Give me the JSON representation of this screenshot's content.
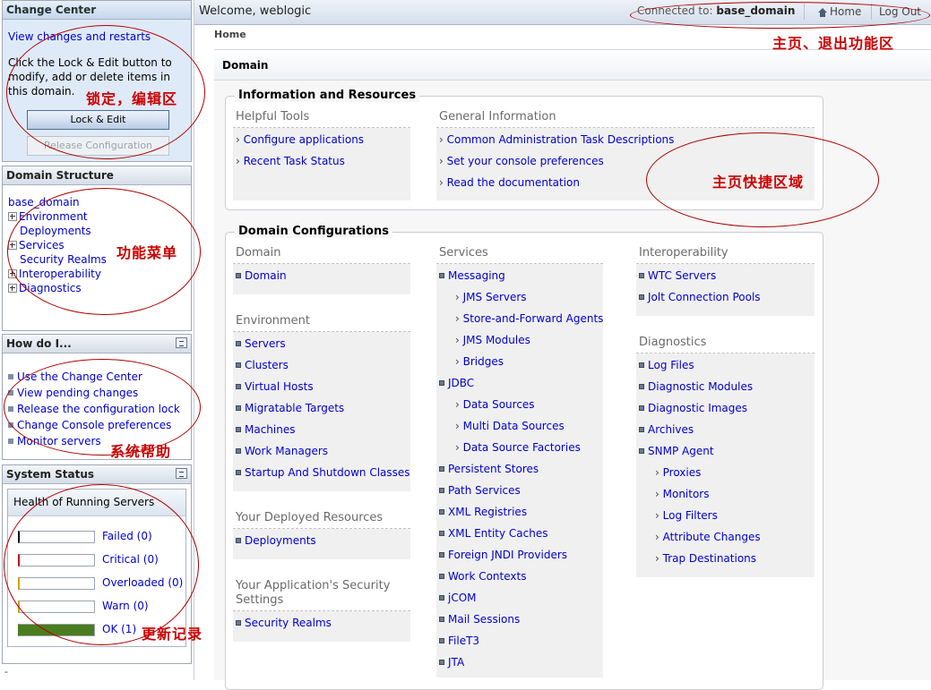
{
  "change_center": {
    "title": "Change Center",
    "link": "View changes and restarts",
    "text": "Click the Lock & Edit button to modify, add or delete items in this domain.",
    "lock_button": "Lock & Edit",
    "release_button": "Release Configuration"
  },
  "domain_structure": {
    "title": "Domain Structure",
    "root": "base_domain",
    "items": [
      {
        "label": "Environment",
        "expandable": true
      },
      {
        "label": "Deployments",
        "expandable": false
      },
      {
        "label": "Services",
        "expandable": true
      },
      {
        "label": "Security Realms",
        "expandable": false
      },
      {
        "label": "Interoperability",
        "expandable": true
      },
      {
        "label": "Diagnostics",
        "expandable": true
      }
    ]
  },
  "how_do_i": {
    "title": "How do I...",
    "items": [
      "Use the Change Center",
      "View pending changes",
      "Release the configuration lock",
      "Change Console preferences",
      "Monitor servers"
    ]
  },
  "system_status": {
    "title": "System Status",
    "health_title": "Health of Running Servers",
    "rows": [
      {
        "label": "Failed (0)",
        "color": "#000000",
        "fill": 0.0
      },
      {
        "label": "Critical (0)",
        "color": "#cc0000",
        "fill": 0.0
      },
      {
        "label": "Overloaded (0)",
        "color": "#d4a017",
        "fill": 0.0
      },
      {
        "label": "Warn (0)",
        "color": "#d4a017",
        "fill": 0.0
      },
      {
        "label": "OK (1)",
        "color": "#4a7d1e",
        "fill": 1.0
      }
    ],
    "footer": "-"
  },
  "topbar": {
    "welcome": "Welcome, weblogic",
    "connected_label": "Connected to:",
    "connected_domain": "base_domain",
    "home": "Home",
    "logout": "Log Out"
  },
  "breadcrumb": "Home",
  "page_title": "Domain",
  "info_resources": {
    "title": "Information and Resources",
    "helpful_tools": {
      "heading": "Helpful Tools",
      "items": [
        "Configure applications",
        "Recent Task Status"
      ]
    },
    "general_info": {
      "heading": "General Information",
      "items": [
        "Common Administration Task Descriptions",
        "Set your console preferences",
        "Read the documentation"
      ]
    }
  },
  "domain_config": {
    "title": "Domain Configurations",
    "col1": [
      {
        "heading": "Domain",
        "items": [
          "Domain"
        ]
      },
      {
        "heading": "Environment",
        "items": [
          "Servers",
          "Clusters",
          "Virtual Hosts",
          "Migratable Targets",
          "Machines",
          "Work Managers",
          "Startup And Shutdown Classes"
        ]
      },
      {
        "heading": "Your Deployed Resources",
        "items": [
          "Deployments"
        ]
      },
      {
        "heading": "Your Application's Security Settings",
        "items": [
          "Security Realms"
        ]
      }
    ],
    "col2": {
      "heading": "Services",
      "items": [
        {
          "label": "Messaging",
          "sub": false
        },
        {
          "label": "JMS Servers",
          "sub": true
        },
        {
          "label": "Store-and-Forward Agents",
          "sub": true
        },
        {
          "label": "JMS Modules",
          "sub": true
        },
        {
          "label": "Bridges",
          "sub": true
        },
        {
          "label": "JDBC",
          "sub": false
        },
        {
          "label": "Data Sources",
          "sub": true
        },
        {
          "label": "Multi Data Sources",
          "sub": true
        },
        {
          "label": "Data Source Factories",
          "sub": true
        },
        {
          "label": "Persistent Stores",
          "sub": false
        },
        {
          "label": "Path Services",
          "sub": false
        },
        {
          "label": "XML Registries",
          "sub": false
        },
        {
          "label": "XML Entity Caches",
          "sub": false
        },
        {
          "label": "Foreign JNDI Providers",
          "sub": false
        },
        {
          "label": "Work Contexts",
          "sub": false
        },
        {
          "label": "jCOM",
          "sub": false
        },
        {
          "label": "Mail Sessions",
          "sub": false
        },
        {
          "label": "FileT3",
          "sub": false
        },
        {
          "label": "JTA",
          "sub": false
        }
      ]
    },
    "col3": [
      {
        "heading": "Interoperability",
        "items": [
          {
            "label": "WTC Servers",
            "sub": false
          },
          {
            "label": "Jolt Connection Pools",
            "sub": false
          }
        ]
      },
      {
        "heading": "Diagnostics",
        "items": [
          {
            "label": "Log Files",
            "sub": false
          },
          {
            "label": "Diagnostic Modules",
            "sub": false
          },
          {
            "label": "Diagnostic Images",
            "sub": false
          },
          {
            "label": "Archives",
            "sub": false
          },
          {
            "label": "SNMP Agent",
            "sub": false
          },
          {
            "label": "Proxies",
            "sub": true
          },
          {
            "label": "Monitors",
            "sub": true
          },
          {
            "label": "Log Filters",
            "sub": true
          },
          {
            "label": "Attribute Changes",
            "sub": true
          },
          {
            "label": "Trap Destinations",
            "sub": true
          }
        ]
      }
    ]
  },
  "annotations": {
    "home_logout": "主页、退出功能区",
    "lock_edit": "锁定，编辑区",
    "shortcuts": "主页快捷区域",
    "menu": "功能菜单",
    "help": "系统帮助",
    "status": "更新记录"
  }
}
